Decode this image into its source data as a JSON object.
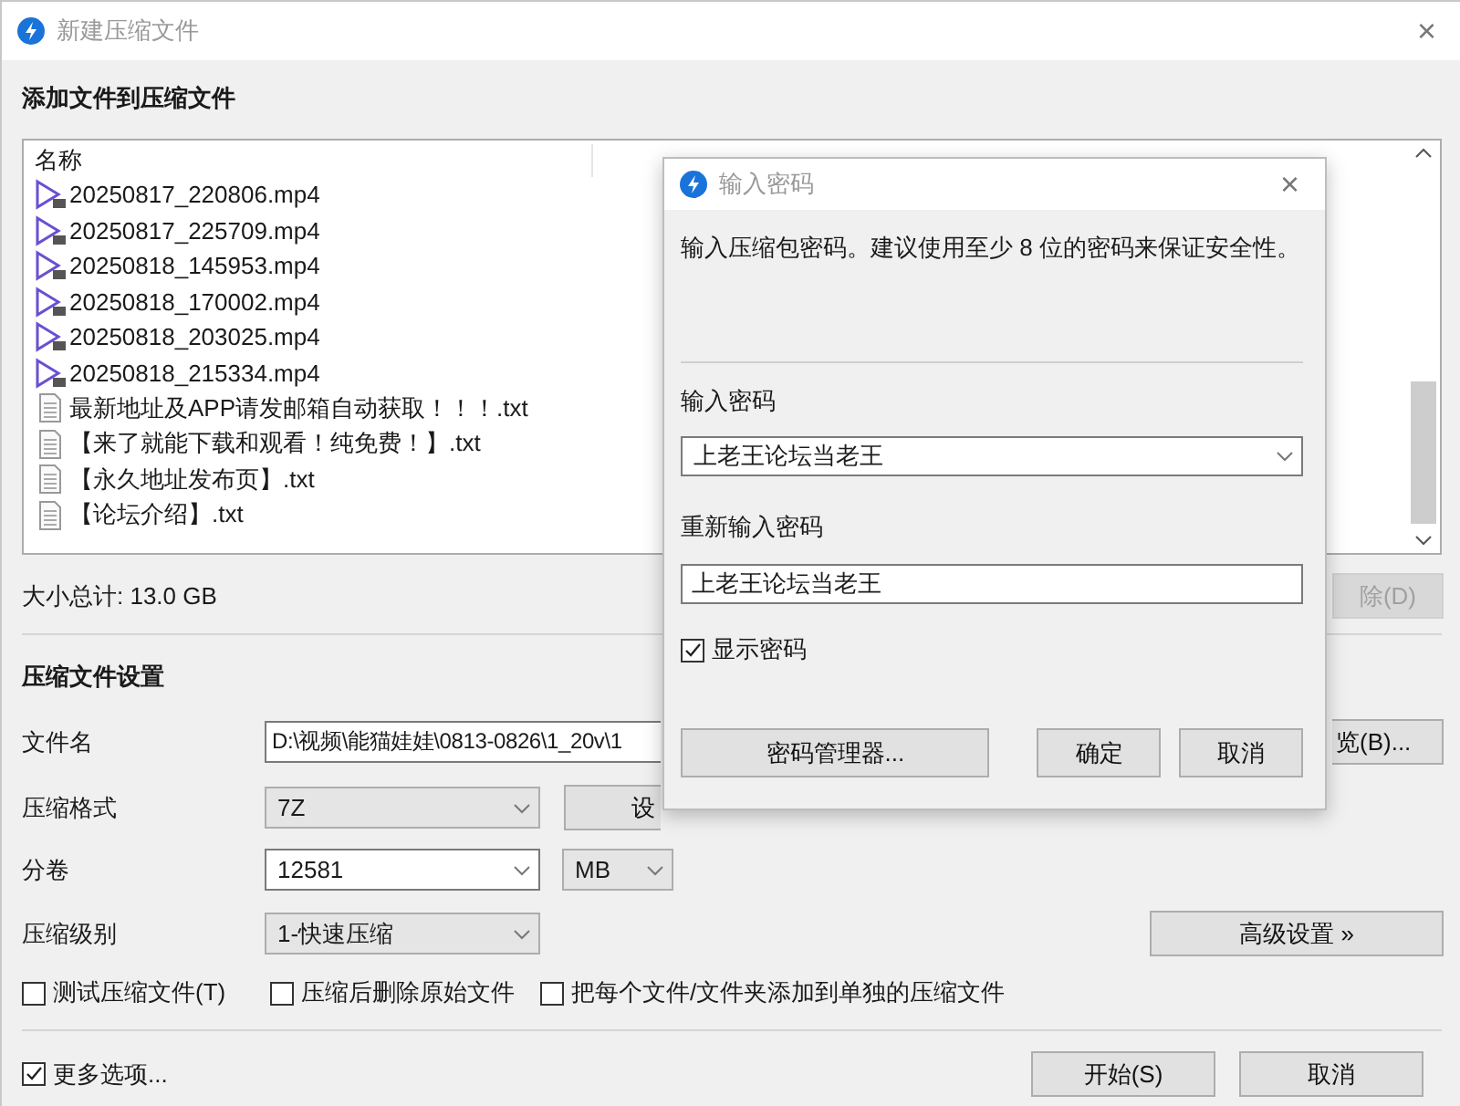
{
  "window": {
    "title": "新建压缩文件",
    "close": "×"
  },
  "files_section": {
    "heading": "添加文件到压缩文件",
    "column_1": "名称",
    "files": [
      {
        "name": "20250817_220806.mp4",
        "kind": "video"
      },
      {
        "name": "20250817_225709.mp4",
        "kind": "video"
      },
      {
        "name": "20250818_145953.mp4",
        "kind": "video"
      },
      {
        "name": "20250818_170002.mp4",
        "kind": "video"
      },
      {
        "name": "20250818_203025.mp4",
        "kind": "video"
      },
      {
        "name": "20250818_215334.mp4",
        "kind": "video"
      },
      {
        "name": "最新地址及APP请发邮箱自动获取！！！.txt",
        "kind": "text"
      },
      {
        "name": "【来了就能下载和观看！纯免费！】.txt",
        "kind": "text"
      },
      {
        "name": "【永久地址发布页】.txt",
        "kind": "text"
      },
      {
        "name": "【论坛介绍】.txt",
        "kind": "text"
      }
    ]
  },
  "total_size": "大小总计: 13.0 GB",
  "delete_button": {
    "label": "除(D)",
    "disabled": true
  },
  "settings": {
    "heading": "压缩文件设置",
    "file_name": {
      "label": "文件名",
      "value": "D:\\视频\\能猫娃娃\\0813-0826\\1_20v\\1"
    },
    "browse_button": {
      "label": "览(B)...",
      "disabled": false
    },
    "format": {
      "label": "压缩格式",
      "value": "7Z",
      "editable": false
    },
    "format_button": {
      "label": "设",
      "disabled": false
    },
    "split": {
      "label": "分卷",
      "value": "12581",
      "editable": true,
      "unit": "MB"
    },
    "level": {
      "label": "压缩级别",
      "value": "1-快速压缩",
      "editable": false
    },
    "advanced_button": {
      "label": "高级设置 »",
      "disabled": false
    }
  },
  "options": [
    {
      "label": "测试压缩文件(T)",
      "checked": false
    },
    {
      "label": "压缩后删除原始文件",
      "checked": false
    },
    {
      "label": "把每个文件/文件夹添加到单独的压缩文件",
      "checked": false
    }
  ],
  "more_options": {
    "label": "更多选项...",
    "checked": true
  },
  "buttons": [
    {
      "label": "开始(S)",
      "disabled": false
    },
    {
      "label": "取消",
      "disabled": false
    }
  ],
  "password_dialog": {
    "title": "输入密码",
    "close": "×",
    "message": "输入压缩包密码。建议使用至少 8 位的密码来保证安全性。",
    "password_label": "输入密码",
    "password": "上老王论坛当老王",
    "confirm_label": "重新输入密码",
    "confirm_password": "上老王论坛当老王",
    "show_password": {
      "label": "显示密码",
      "checked": true
    },
    "buttons": [
      {
        "label": "密码管理器...",
        "disabled": false
      },
      {
        "label": "确定",
        "disabled": false
      },
      {
        "label": "取消",
        "disabled": false
      }
    ]
  }
}
